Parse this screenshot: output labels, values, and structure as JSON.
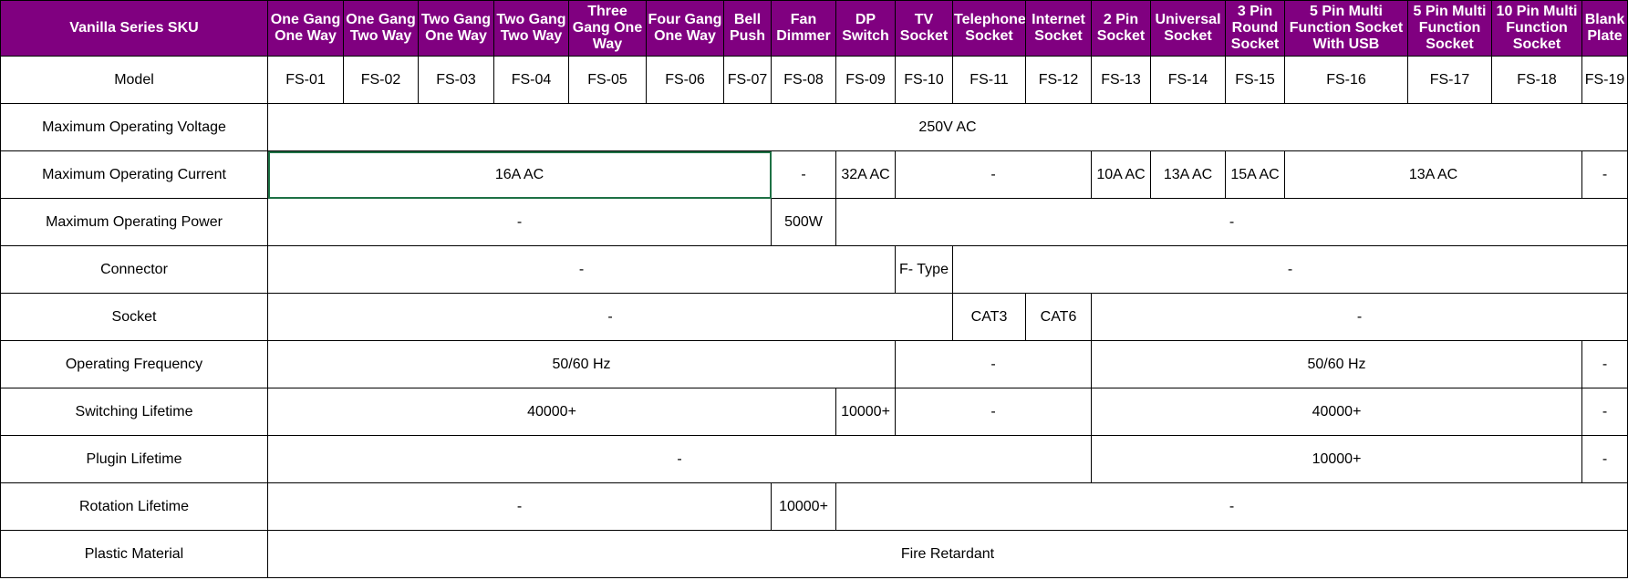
{
  "header": {
    "sku_label": "Vanilla Series SKU",
    "columns": [
      "One Gang One Way",
      "One Gang Two Way",
      "Two Gang One Way",
      "Two Gang Two Way",
      "Three Gang One Way",
      "Four Gang One Way",
      "Bell Push",
      "Fan Dimmer",
      "DP Switch",
      "TV Socket",
      "Telephone Socket",
      "Internet Socket",
      "2 Pin Socket",
      "Universal Socket",
      "3 Pin Round Socket",
      "5 Pin Multi Function Socket With USB",
      "5 Pin Multi Function Socket",
      "10 Pin Multi Function Socket",
      "Blank Plate"
    ]
  },
  "rows": {
    "model": {
      "label": "Model",
      "values": [
        "FS-01",
        "FS-02",
        "FS-03",
        "FS-04",
        "FS-05",
        "FS-06",
        "FS-07",
        "FS-08",
        "FS-09",
        "FS-10",
        "FS-11",
        "FS-12",
        "FS-13",
        "FS-14",
        "FS-15",
        "FS-16",
        "FS-17",
        "FS-18",
        "FS-19"
      ]
    },
    "max_voltage": {
      "label": "Maximum Operating Voltage",
      "value": "250V AC"
    },
    "max_current": {
      "label": "Maximum Operating Current",
      "values": [
        "16A AC",
        "-",
        "32A AC",
        "-",
        "10A AC",
        "13A AC",
        "15A AC",
        "13A AC",
        "-"
      ]
    },
    "max_power": {
      "label": "Maximum Operating Power",
      "values": [
        "-",
        "500W",
        "-"
      ]
    },
    "connector": {
      "label": "Connector",
      "values": [
        "-",
        "F- Type",
        "-"
      ]
    },
    "socket": {
      "label": "Socket",
      "values": [
        "-",
        "CAT3",
        "CAT6",
        "-"
      ]
    },
    "frequency": {
      "label": "Operating Frequency",
      "values": [
        "50/60 Hz",
        "-",
        "50/60 Hz",
        "-"
      ]
    },
    "switching_lifetime": {
      "label": "Switching Lifetime",
      "values": [
        "40000+",
        "10000+",
        "-",
        "40000+",
        "-"
      ]
    },
    "plugin_lifetime": {
      "label": "Plugin Lifetime",
      "values": [
        "-",
        "10000+",
        "-"
      ]
    },
    "rotation_lifetime": {
      "label": "Rotation Lifetime",
      "values": [
        "-",
        "10000+",
        "-"
      ]
    },
    "plastic_material": {
      "label": "Plastic Material",
      "value": "Fire Retardant"
    }
  },
  "colors": {
    "header_background": "#800080",
    "header_text": "#ffffff",
    "selection_border": "#1e7145"
  }
}
